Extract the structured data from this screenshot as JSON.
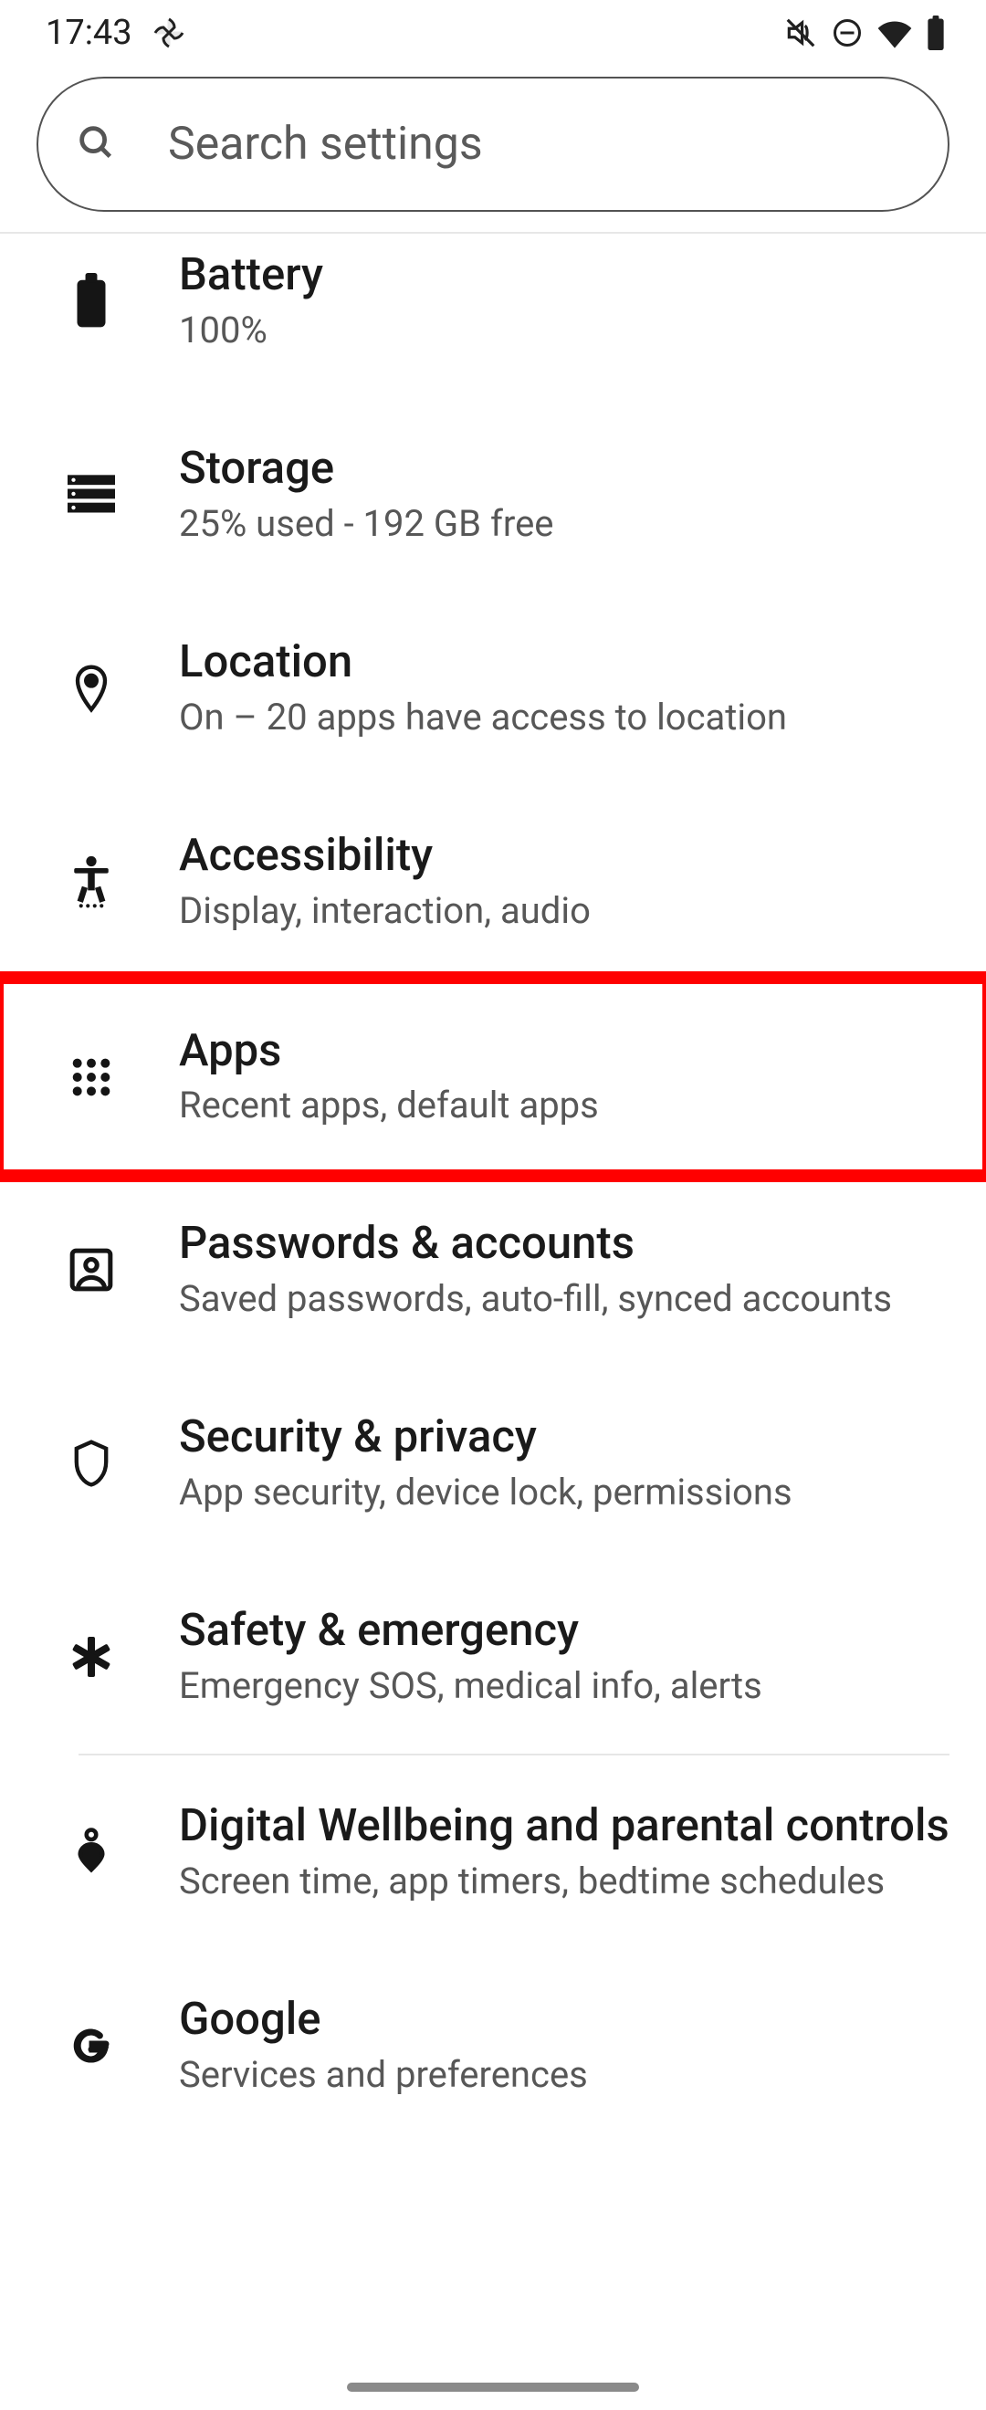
{
  "status": {
    "time": "17:43"
  },
  "search": {
    "placeholder": "Search settings"
  },
  "items": [
    {
      "key": "battery",
      "title": "Battery",
      "sub": "100%"
    },
    {
      "key": "storage",
      "title": "Storage",
      "sub": "25% used - 192 GB free"
    },
    {
      "key": "location",
      "title": "Location",
      "sub": "On – 20 apps have access to location"
    },
    {
      "key": "accessibility",
      "title": "Accessibility",
      "sub": "Display, interaction, audio"
    },
    {
      "key": "apps",
      "title": "Apps",
      "sub": "Recent apps, default apps"
    },
    {
      "key": "passwords",
      "title": "Passwords & accounts",
      "sub": "Saved passwords, auto-fill, synced accounts"
    },
    {
      "key": "security",
      "title": "Security & privacy",
      "sub": "App security, device lock, permissions"
    },
    {
      "key": "safety",
      "title": "Safety & emergency",
      "sub": "Emergency SOS, medical info, alerts"
    },
    {
      "key": "wellbeing",
      "title": "Digital Wellbeing and parental controls",
      "sub": "Screen time, app timers, bedtime schedules"
    },
    {
      "key": "google",
      "title": "Google",
      "sub": "Services and preferences"
    }
  ],
  "highlight": {
    "item_key": "apps"
  }
}
